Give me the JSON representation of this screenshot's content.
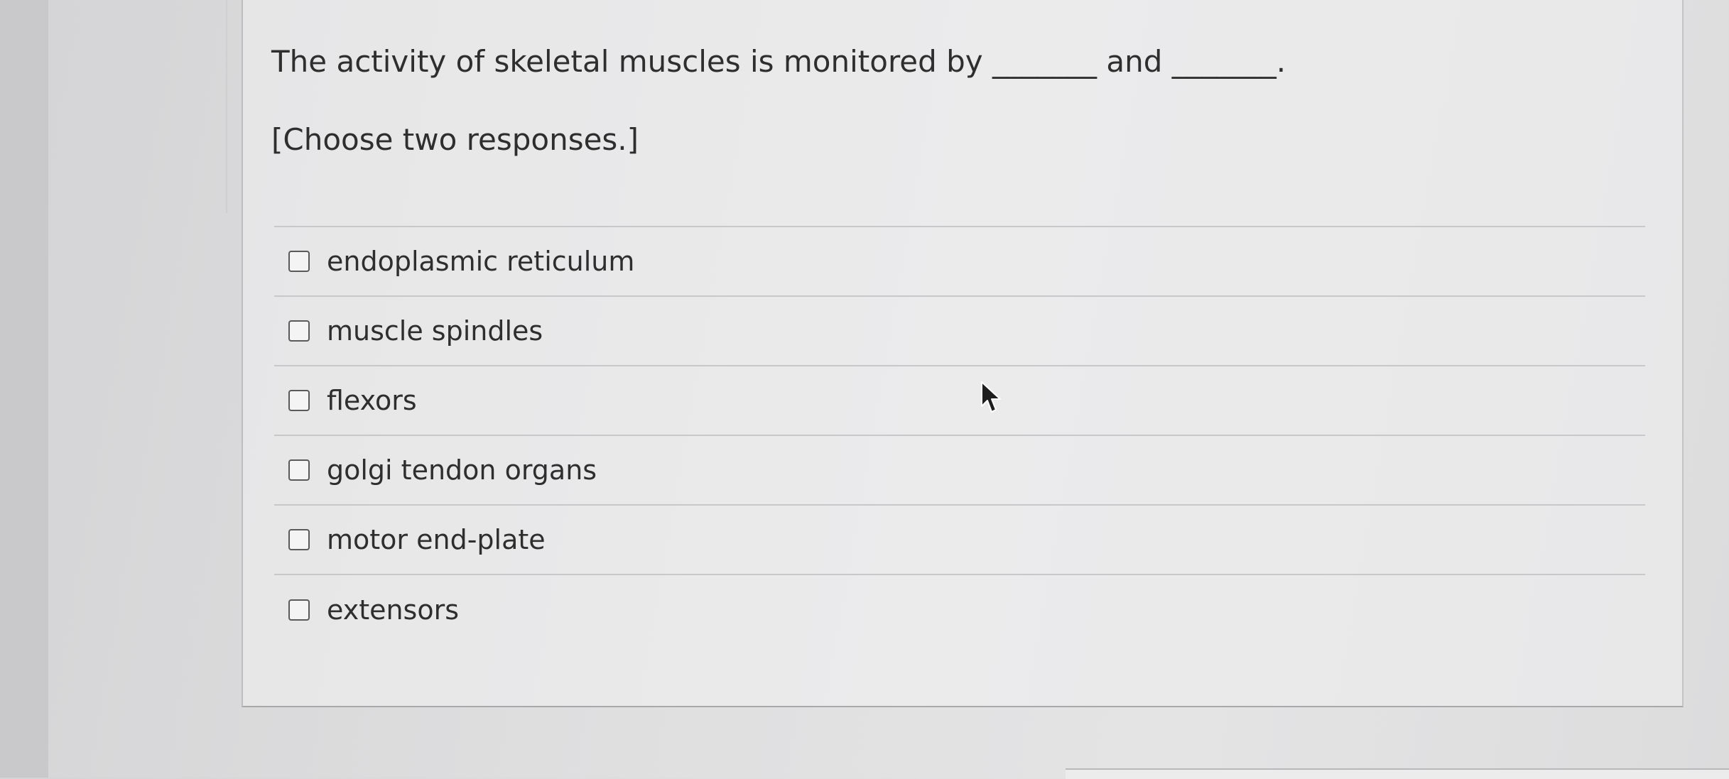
{
  "question": {
    "prompt": "The activity of skeletal muscles is monitored by _______ and _______.",
    "instruction": "[Choose two responses.]"
  },
  "options": [
    {
      "label": "endoplasmic reticulum",
      "checked": false
    },
    {
      "label": "muscle spindles",
      "checked": false
    },
    {
      "label": "flexors",
      "checked": false
    },
    {
      "label": "golgi tendon organs",
      "checked": false
    },
    {
      "label": "motor end-plate",
      "checked": false
    },
    {
      "label": "extensors",
      "checked": false
    }
  ],
  "icons": {
    "cursor": "mouse-pointer-icon"
  }
}
